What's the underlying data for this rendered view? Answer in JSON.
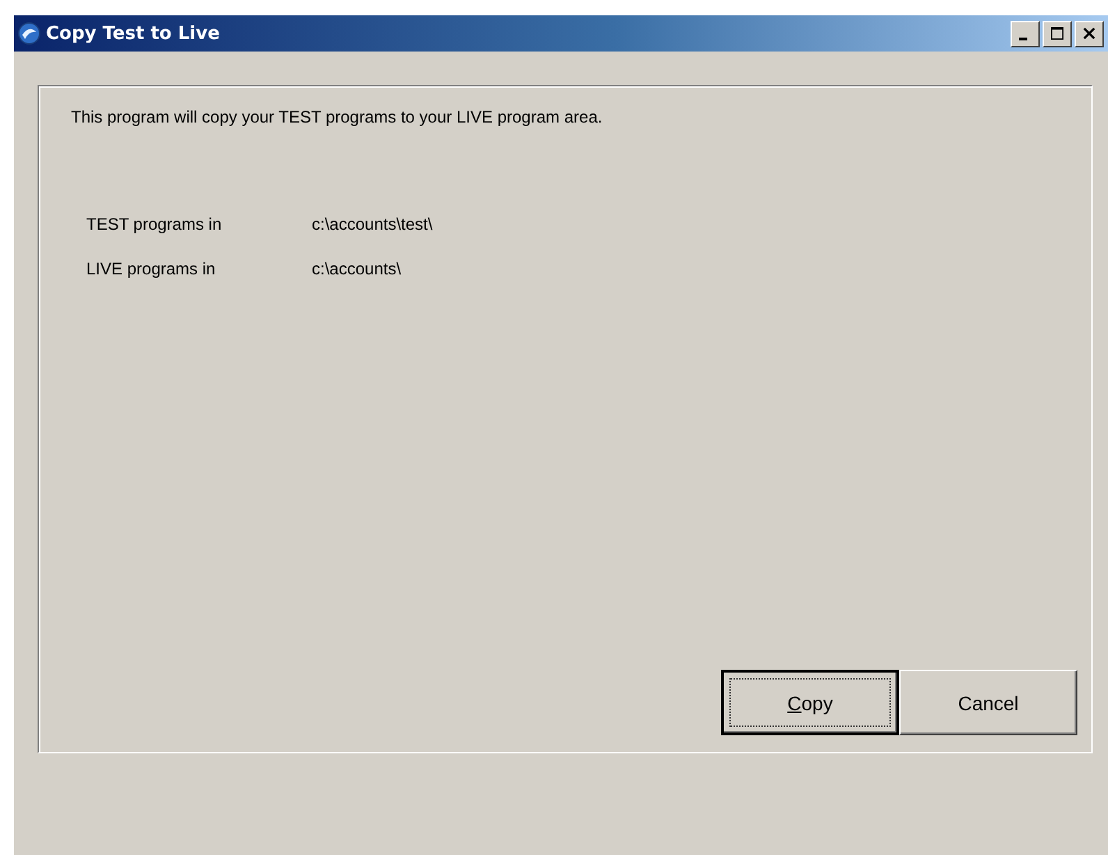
{
  "window": {
    "title": "Copy Test to Live"
  },
  "message": "This program will copy your TEST programs to your LIVE program area.",
  "paths": [
    {
      "label": "TEST programs in",
      "value": "c:\\accounts\\test\\"
    },
    {
      "label": "LIVE programs in",
      "value": "c:\\accounts\\"
    }
  ],
  "buttons": [
    {
      "label": "Copy",
      "default": true,
      "mnemonic_first": true
    },
    {
      "label": "Cancel",
      "default": false,
      "mnemonic_first": false
    }
  ]
}
